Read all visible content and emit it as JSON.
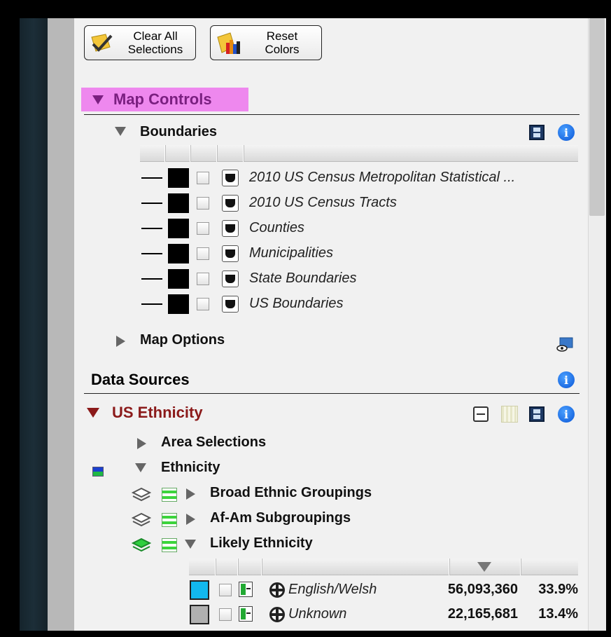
{
  "toolbar": {
    "clear_all_label": "Clear All\nSelections",
    "reset_colors_label": "Reset\nColors"
  },
  "map_controls": {
    "title": "Map Controls",
    "boundaries": {
      "title": "Boundaries",
      "layers": [
        {
          "label": "2010 US Census Metropolitan Statistical ..."
        },
        {
          "label": "2010 US Census Tracts"
        },
        {
          "label": "Counties"
        },
        {
          "label": "Municipalities"
        },
        {
          "label": "State Boundaries"
        },
        {
          "label": "US Boundaries"
        }
      ]
    },
    "map_options": {
      "title": "Map Options"
    }
  },
  "data_sources": {
    "title": "Data Sources",
    "dataset": {
      "title": "US Ethnicity",
      "area_selections": "Area Selections",
      "ethnicity": "Ethnicity",
      "groups": [
        {
          "label": "Broad Ethnic Groupings"
        },
        {
          "label": "Af-Am Subgroupings"
        },
        {
          "label": "Likely Ethnicity"
        }
      ],
      "rows": [
        {
          "label": "English/Welsh",
          "count": "56,093,360",
          "pct": "33.9%",
          "color": "#12b8ee"
        },
        {
          "label": "Unknown",
          "count": "22,165,681",
          "pct": "13.4%",
          "color": "#b0b0b0"
        }
      ]
    }
  },
  "colors": {
    "highlight": "#ee88ee",
    "map_controls_text": "#7a1f80",
    "dataset_title": "#8b1a1a",
    "info_blue": "#0a56d6"
  }
}
